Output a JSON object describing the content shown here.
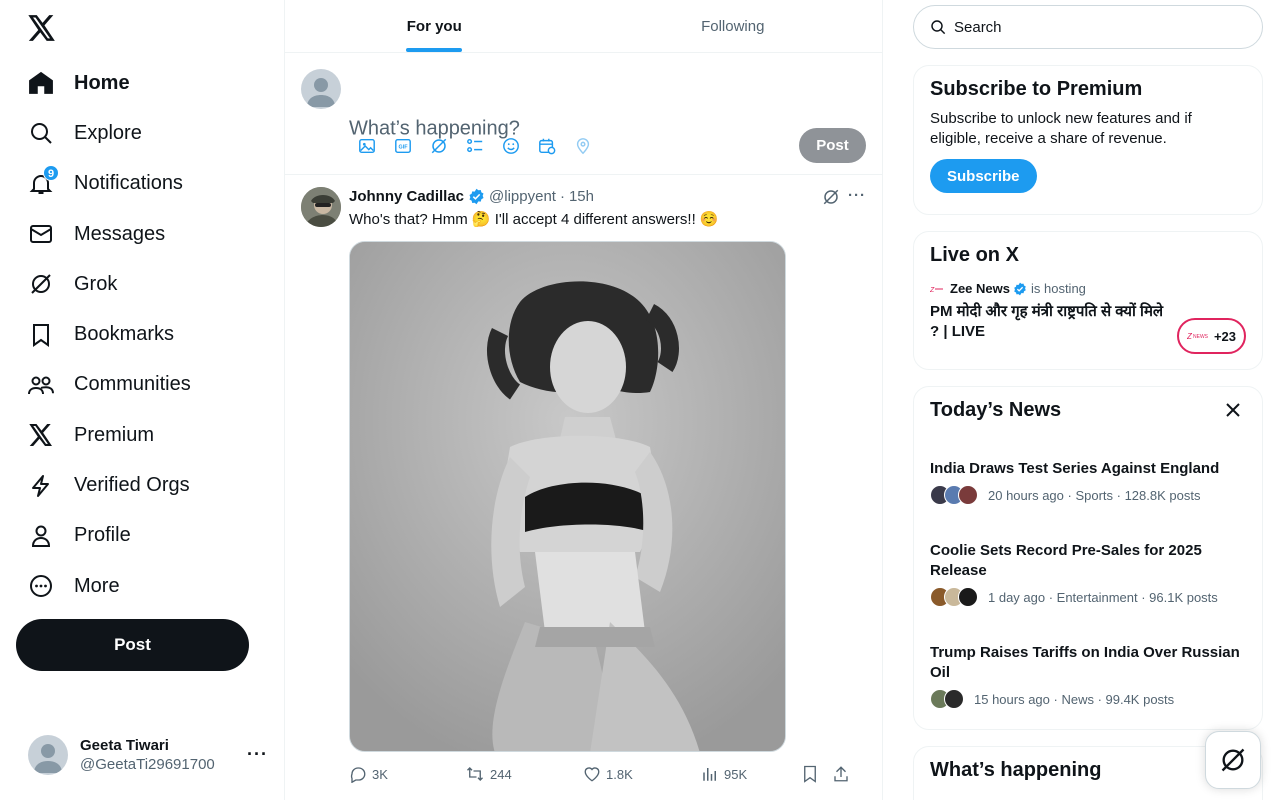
{
  "nav": {
    "items": [
      {
        "label": "Home",
        "icon": "home-icon"
      },
      {
        "label": "Explore",
        "icon": "search-icon"
      },
      {
        "label": "Notifications",
        "icon": "bell-icon",
        "badge": "9"
      },
      {
        "label": "Messages",
        "icon": "envelope-icon"
      },
      {
        "label": "Grok",
        "icon": "grok-icon"
      },
      {
        "label": "Bookmarks",
        "icon": "bookmark-icon"
      },
      {
        "label": "Communities",
        "icon": "communities-icon"
      },
      {
        "label": "Premium",
        "icon": "x-logo-icon"
      },
      {
        "label": "Verified Orgs",
        "icon": "lightning-icon"
      },
      {
        "label": "Profile",
        "icon": "person-icon"
      },
      {
        "label": "More",
        "icon": "more-circle-icon"
      }
    ],
    "post_label": "Post"
  },
  "account": {
    "name": "Geeta Tiwari",
    "handle": "@GeetaTi29691700"
  },
  "feed": {
    "tabs": [
      {
        "label": "For you"
      },
      {
        "label": "Following"
      }
    ],
    "compose_placeholder": "What’s happening?",
    "post_label": "Post"
  },
  "tweet": {
    "author": "Johnny Cadillac",
    "handle": "@lippyent",
    "dot": "·",
    "time": "15h",
    "text": "Who's that? Hmm 🤔 I'll accept 4 different answers!! ☺️",
    "replies": "3K",
    "reposts": "244",
    "likes": "1.8K",
    "views": "95K"
  },
  "sidebar": {
    "search_placeholder": "Search",
    "premium": {
      "title": "Subscribe to Premium",
      "body": "Subscribe to unlock new features and if eligible, receive a share of revenue.",
      "button": "Subscribe"
    },
    "live": {
      "title": "Live on X",
      "host": "Zee News",
      "host_suffix": "is hosting",
      "stream_title": "PM मोदी और गृह मंत्री राष्ट्रपति से क्यों मिले ? | LIVE",
      "count": "+23"
    },
    "news": {
      "title": "Today’s News",
      "items": [
        {
          "title": "India Draws Test Series Against England",
          "meta": "20 hours ago · Sports · 128.8K posts"
        },
        {
          "title": "Coolie Sets Record Pre-Sales for 2025 Release",
          "meta": "1 day ago · Entertainment · 96.1K posts"
        },
        {
          "title": "Trump Raises Tariffs on India Over Russian Oil",
          "meta": "15 hours ago · News · 99.4K posts"
        }
      ]
    },
    "happening_title": "What’s happening"
  },
  "colors": {
    "accent": "#1d9bf0",
    "text": "#0f1419",
    "muted": "#536471",
    "live": "#e0245e"
  }
}
